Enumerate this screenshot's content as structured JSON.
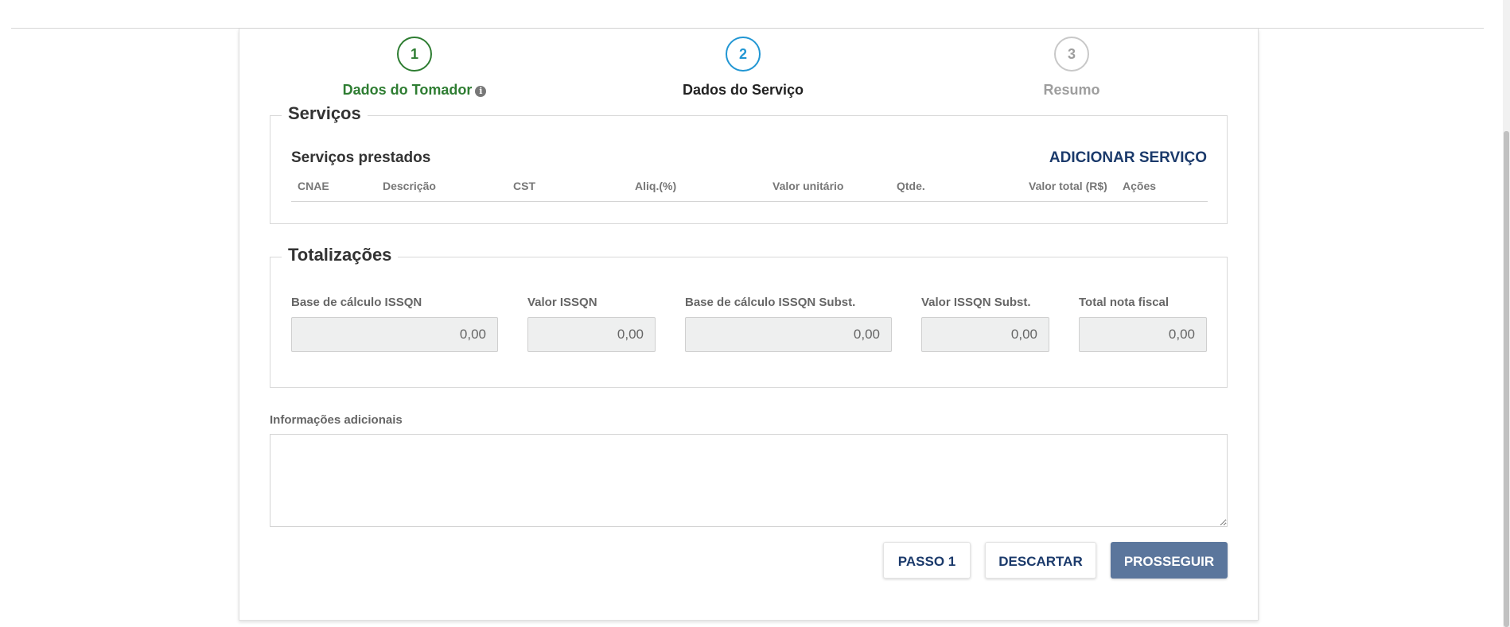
{
  "steps": [
    {
      "number": "1",
      "label": "Dados do Tomador",
      "state": "completed",
      "icon": "info-circle-icon"
    },
    {
      "number": "2",
      "label": "Dados do Serviço",
      "state": "active"
    },
    {
      "number": "3",
      "label": "Resumo",
      "state": "pending"
    }
  ],
  "services": {
    "legend": "Serviços",
    "subtitle": "Serviços prestados",
    "add_label": "ADICIONAR SERVIÇO",
    "columns": [
      "CNAE",
      "Descrição",
      "CST",
      "Aliq.(%)",
      "Valor unitário",
      "Qtde.",
      "Valor total (R$)",
      "Ações"
    ]
  },
  "totals": {
    "legend": "Totalizações",
    "fields": [
      {
        "label": "Base de cálculo ISSQN",
        "value": "0,00"
      },
      {
        "label": "Valor ISSQN",
        "value": "0,00"
      },
      {
        "label": "Base de cálculo ISSQN Subst.",
        "value": "0,00"
      },
      {
        "label": "Valor ISSQN Subst.",
        "value": "0,00"
      },
      {
        "label": "Total nota fiscal",
        "value": "0,00"
      }
    ]
  },
  "additional_info": {
    "label": "Informações adicionais",
    "value": ""
  },
  "actions": {
    "step1_label": "PASSO 1",
    "discard_label": "DESCARTAR",
    "proceed_label": "PROSSEGUIR"
  },
  "colors": {
    "completed": "#2e7d32",
    "active": "#2196d3",
    "pending": "#9e9e9e",
    "link": "#1b3a6b",
    "primary_button": "#5b769c"
  }
}
